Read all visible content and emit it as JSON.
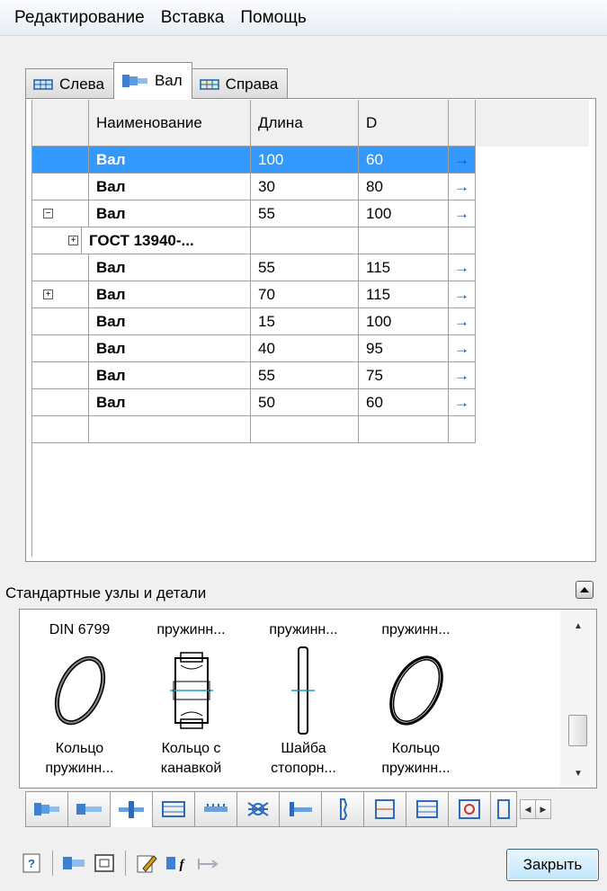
{
  "menu": [
    "Редактирование",
    "Вставка",
    "Помощь"
  ],
  "tabs": [
    {
      "label": "Слева",
      "icon": "shaft-left-icon"
    },
    {
      "label": "Вал",
      "icon": "shaft-icon"
    },
    {
      "label": "Справа",
      "icon": "shaft-right-icon"
    }
  ],
  "grid": {
    "headers": {
      "name": "Наименование",
      "length": "Длина",
      "d": "D"
    },
    "rows": [
      {
        "expander": "",
        "name": "Вал",
        "length": "100",
        "d": "60",
        "arrow": "→"
      },
      {
        "expander": "",
        "name": "Вал",
        "length": "30",
        "d": "80",
        "arrow": "→"
      },
      {
        "expander": "−",
        "name": "Вал",
        "length": "55",
        "d": "100",
        "arrow": "→"
      },
      {
        "expander": "+",
        "name": "ГОСТ 13940-...",
        "length": "",
        "d": "",
        "arrow": ""
      },
      {
        "expander": "",
        "name": "Вал",
        "length": "55",
        "d": "115",
        "arrow": "→"
      },
      {
        "expander": "+",
        "name": "Вал",
        "length": "70",
        "d": "115",
        "arrow": "→"
      },
      {
        "expander": "",
        "name": "Вал",
        "length": "15",
        "d": "100",
        "arrow": "→"
      },
      {
        "expander": "",
        "name": "Вал",
        "length": "40",
        "d": "95",
        "arrow": "→"
      },
      {
        "expander": "",
        "name": "Вал",
        "length": "55",
        "d": "75",
        "arrow": "→"
      },
      {
        "expander": "",
        "name": "Вал",
        "length": "50",
        "d": "60",
        "arrow": "→"
      },
      {
        "expander": "",
        "name": "",
        "length": "",
        "d": "",
        "arrow": ""
      }
    ]
  },
  "section_label": "Стандартные узлы и детали",
  "gallery": [
    {
      "title": "DIN 6799",
      "caption1": "Кольцо",
      "caption2": "пружинн...",
      "icon": "spring-ring-icon"
    },
    {
      "title": "пружинн...",
      "caption1": "Кольцо с",
      "caption2": "канавкой",
      "icon": "grooved-ring-icon"
    },
    {
      "title": "пружинн...",
      "caption1": "Шайба",
      "caption2": "стопорн...",
      "icon": "lock-washer-icon"
    },
    {
      "title": "пружинн...",
      "caption1": "Кольцо",
      "caption2": "пружинн...",
      "icon": "spring-ring-icon"
    }
  ],
  "close_label": "Закрыть"
}
